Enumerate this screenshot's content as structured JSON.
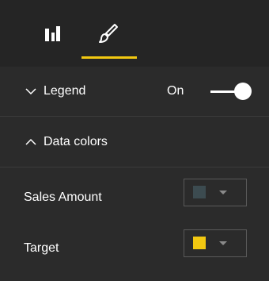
{
  "tabs": [
    {
      "name": "fields",
      "icon": "bar-chart-icon"
    },
    {
      "name": "format",
      "icon": "paintbrush-icon",
      "active": true
    }
  ],
  "colors": {
    "background": "#2b2b2b",
    "tabbar": "#252525",
    "accent": "#f2c811",
    "sales_swatch": "#3c4b50",
    "target_swatch": "#f2c811"
  },
  "sections": {
    "legend": {
      "label": "Legend",
      "expanded": false,
      "toggle_label": "On",
      "toggle_on": true
    },
    "data_colors": {
      "label": "Data colors",
      "expanded": true
    }
  },
  "data_colors": [
    {
      "label": "Sales Amount",
      "color": "#3c4b50"
    },
    {
      "label": "Target",
      "color": "#f2c811"
    }
  ]
}
